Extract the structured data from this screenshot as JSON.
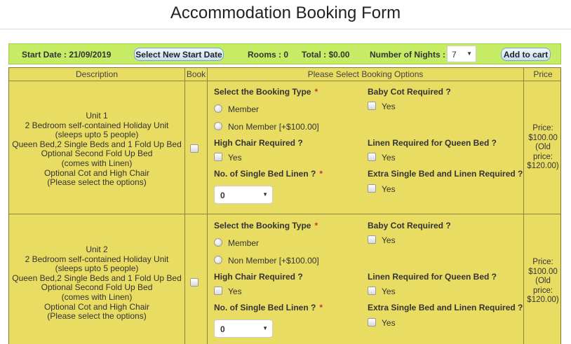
{
  "title": "Accommodation Booking Form",
  "topbar": {
    "start_date": "Start Date : 21/09/2019",
    "new_start_button": "Select New Start Date",
    "rooms": "Rooms : 0",
    "total": "Total : $0.00",
    "nights_label": "Number of Nights :",
    "nights_value": "7",
    "add_to_cart": "Add to cart"
  },
  "table": {
    "headers": {
      "description": "Description",
      "book": "Book",
      "options": "Please Select Booking Options",
      "price": "Price"
    }
  },
  "labels": {
    "booking_type": "Select the Booking Type",
    "member": "Member",
    "non_member": "Non Member [+$100.00]",
    "high_chair": "High Chair Required ?",
    "single_bed_linen": "No. of Single Bed Linen ?",
    "baby_cot": "Baby Cot Required ?",
    "linen_queen": "Linen Required for Queen Bed ?",
    "extra_single": "Extra Single Bed and Linen Required ?",
    "yes": "Yes",
    "required_mark": "*"
  },
  "units": [
    {
      "name": "Unit 1",
      "lines": [
        "2 Bedroom self-contained Holiday Unit",
        "(sleeps upto 5 people)",
        "Queen Bed,2 Single Beds and 1 Fold Up Bed",
        "Optional Second Fold Up Bed",
        "(comes with Linen)",
        "Optional Cot and High Chair",
        "(Please select the options)"
      ],
      "price_lines": [
        "Price:",
        "$100.00",
        "(Old",
        "price:",
        "$120.00)"
      ],
      "linen_count": "0"
    },
    {
      "name": "Unit 2",
      "lines": [
        "2 Bedroom self-contained Holiday Unit",
        "(sleeps upto 5 people)",
        "Queen Bed,2 Single Beds and 1 Fold Up Bed",
        "Optional Second Fold Up Bed",
        "(comes with Linen)",
        "Optional Cot and High Chair",
        "(Please select the options)"
      ],
      "price_lines": [
        "Price:",
        "$100.00",
        "(Old",
        "price:",
        "$120.00)"
      ],
      "linen_count": "0"
    }
  ],
  "colors": {
    "topbar_bg": "#c6ec66",
    "table_bg": "#e8dc62",
    "required": "#c0392b",
    "button_border": "#6ea8cf"
  }
}
